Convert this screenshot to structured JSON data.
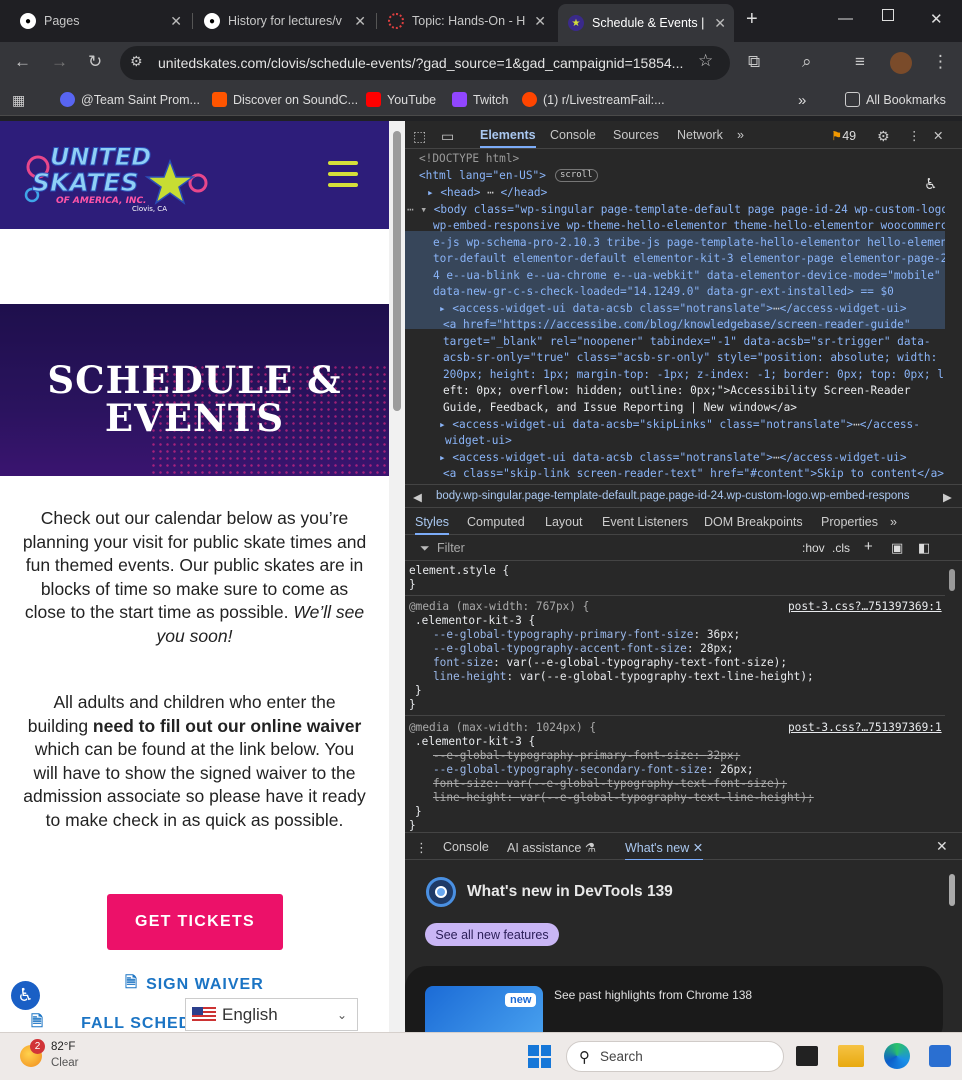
{
  "browser": {
    "tabs": [
      {
        "title": "Pages",
        "icon": "github-icon"
      },
      {
        "title": "History for lectures/v",
        "icon": "github-icon"
      },
      {
        "title": "Topic: Hands-On - H",
        "icon": "loading-icon"
      },
      {
        "title": "Schedule & Events | ",
        "icon": "united-skates-favicon"
      }
    ],
    "url": "unitedskates.com/clovis/schedule-events/?gad_source=1&gad_campaignid=15854...",
    "bookmarks": [
      {
        "label": "@Team Saint Prom...",
        "icon": "discord-icon",
        "color": "#5865f2"
      },
      {
        "label": "Discover on SoundC...",
        "icon": "soundcloud-icon",
        "color": "#ff5500"
      },
      {
        "label": "YouTube",
        "icon": "youtube-icon",
        "color": "#ff0000"
      },
      {
        "label": "Twitch",
        "icon": "twitch-icon",
        "color": "#9146ff"
      },
      {
        "label": "(1) r/LivestreamFail:...",
        "icon": "reddit-icon",
        "color": "#ff4500"
      }
    ],
    "all_bookmarks": "All Bookmarks"
  },
  "page": {
    "logo": {
      "line1": "UNITED",
      "line2": "SKATES",
      "line3": "OF AMERICA, INC.",
      "city": "Clovis, CA"
    },
    "hero_title_1": "SCHEDULE &",
    "hero_title_2": "EVENTS",
    "para1_main": "Check out our calendar below as you’re planning your visit for public skate times and fun themed events. Our public skates are in blocks of time so make sure to come as close to the start time as possible.",
    "para1_italic": "We’ll see you soon!",
    "para2_a": "All adults and children who enter the building ",
    "para2_bold": "need to fill out our online waiver",
    "para2_b": " which can be found at the link below. You will have to show the signed waiver to the admission associate so please have it ready to make check in as quick as possible.",
    "btn_tickets": "GET TICKETS",
    "link_waiver": "SIGN WAIVER",
    "link_fall": "FALL SCHED",
    "language": "English"
  },
  "devtools": {
    "tabs": [
      "Elements",
      "Console",
      "Sources",
      "Network"
    ],
    "issues_count": "49",
    "dom_lines": [
      "<!DOCTYPE html>",
      "<html lang=\"en-US\">",
      "scroll",
      "<head>",
      "</head>",
      "<body class=\"wp-singular page-template-default page page-id-24 wp-custom-logo",
      "wp-embed-responsive wp-theme-hello-elementor theme-hello-elementor woocommerc",
      "e-js wp-schema-pro-2.10.3 tribe-js page-template-hello-elementor hello-elemen",
      "tor-default elementor-default elementor-kit-3 elementor-page elementor-page-2",
      "4 e--ua-blink e--ua-chrome e--ua-webkit\" data-elementor-device-mode=\"mobile\"",
      "data-new-gr-c-s-check-loaded=\"14.1249.0\" data-gr-ext-installed> == $0",
      "<access-widget-ui data-acsb class=\"notranslate\">",
      "</access-widget-ui>",
      "<a href=\"https://accessibe.com/blog/knowledgebase/screen-reader-guide\"",
      "target=\"_blank\" rel=\"noopener\" tabindex=\"-1\" data-acsb=\"sr-trigger\" data-",
      "acsb-sr-only=\"true\" class=\"acsb-sr-only\" style=\"position: absolute; width:",
      "200px; height: 1px; margin-top: -1px; z-index: -1; border: 0px; top: 0px; l",
      "eft: 0px; overflow: hidden; outline: 0px;\">Accessibility Screen-Reader",
      "Guide, Feedback, and Issue Reporting | New window</a>",
      "<access-widget-ui data-acsb=\"skipLinks\" class=\"notranslate\">",
      "</access-",
      "widget-ui>",
      "<access-widget-ui data-acsb class=\"notranslate\">",
      "</access-widget-ui>",
      "<a class=\"skip-link screen-reader-text\" href=\"#content\">Skip to content</a>"
    ],
    "breadcrumb": "body.wp-singular.page-template-default.page.page-id-24.wp-custom-logo.wp-embed-respons",
    "style_tabs": [
      "Styles",
      "Computed",
      "Layout",
      "Event Listeners",
      "DOM Breakpoints",
      "Properties"
    ],
    "filter_placeholder": "Filter",
    "hov": ":hov",
    "cls": ".cls",
    "styles": {
      "element_style": "element.style {",
      "rule1_media": "@media (max-width: 767px) {",
      "rule1_src": "post-3.css?…751397369:1",
      "rule1_sel": ".elementor-kit-3 {",
      "rule1_props": [
        [
          "--e-global-typography-primary-font-size",
          "36px;"
        ],
        [
          "--e-global-typography-accent-font-size",
          "28px;"
        ],
        [
          "font-size",
          "var(--e-global-typography-text-font-size);"
        ],
        [
          "line-height",
          "var(--e-global-typography-text-line-height);"
        ]
      ],
      "rule2_media": "@media (max-width: 1024px) {",
      "rule2_src": "post-3.css?…751397369:1",
      "rule2_sel": ".elementor-kit-3 {",
      "rule2_props": [
        [
          "--e-global-typography-primary-font-size",
          "32px;"
        ],
        [
          "--e-global-typography-secondary-font-size",
          "26px;"
        ],
        [
          "font-size",
          "var(--e-global-typography-text-font-size);"
        ],
        [
          "line-height",
          "var(--e-global-typography-text-line-height);"
        ]
      ]
    },
    "drawer_tabs": [
      "Console",
      "AI assistance",
      "What's new"
    ],
    "whats_new_title": "What's new in DevTools 139",
    "see_all": "See all new features",
    "new_badge": "new",
    "highlights": "See past highlights from Chrome 138"
  },
  "taskbar": {
    "weather_temp": "82°F",
    "weather_cond": "Clear",
    "weather_badge": "2",
    "search": "Search"
  }
}
